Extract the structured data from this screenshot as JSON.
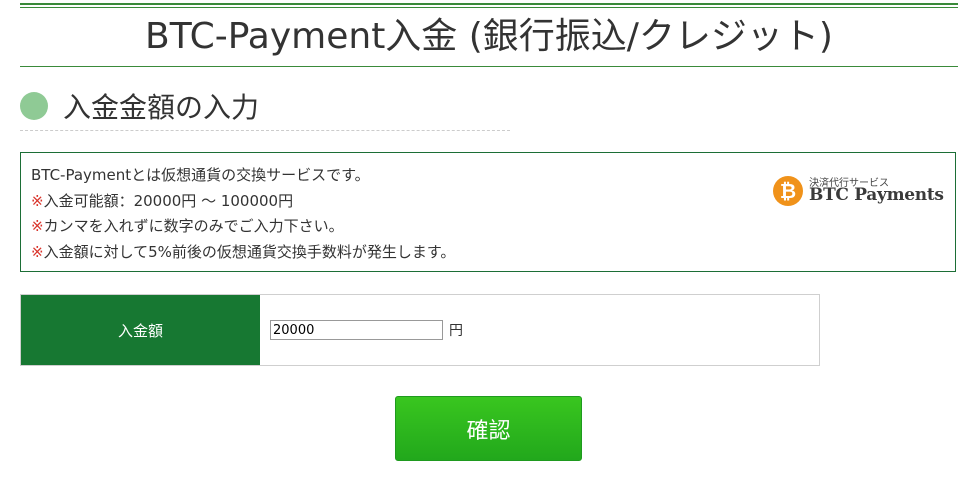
{
  "page": {
    "title": "BTC-Payment入金 (銀行振込/クレジット)"
  },
  "section": {
    "heading": "入金金額の入力"
  },
  "info": {
    "line1": "BTC-Paymentとは仮想通貨の交換サービスです。",
    "line2_mark": "※",
    "line2": "入金可能額：20000円 ～ 100000円",
    "line3_mark": "※",
    "line3": "カンマを入れずに数字のみでご入力下さい。",
    "line4_mark": "※",
    "line4": "入金額に対して5%前後の仮想通貨交換手数料が発生します。"
  },
  "logo": {
    "coin_symbol": "₿",
    "subtitle": "決済代行サービス",
    "name": "BTC Payments"
  },
  "form": {
    "amount_label": "入金額",
    "amount_value": "20000",
    "amount_unit": "円"
  },
  "actions": {
    "confirm_label": "確認"
  },
  "colors": {
    "brand_green": "#177832",
    "button_green": "#2eb81e",
    "note_red": "#d9342b",
    "bitcoin_orange": "#f0921a"
  }
}
